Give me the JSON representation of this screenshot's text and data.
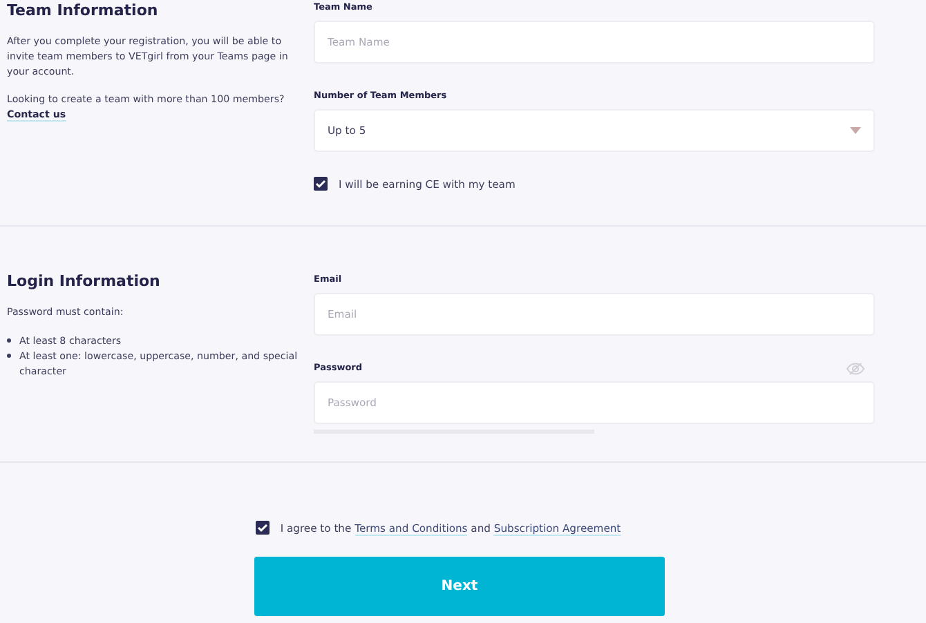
{
  "team_information": {
    "heading": "Team Information",
    "description": "After you complete your registration, you will be able to invite team members to VETgirl from your Teams page in your account.",
    "question": "Looking to create a team with more than 100 members?",
    "contact_link": "Contact us"
  },
  "team_fields": {
    "team_name": {
      "label": "Team Name",
      "placeholder": "Team Name"
    },
    "members": {
      "label": "Number of Team Members",
      "value": "Up to 5"
    },
    "ce_checkbox": {
      "label": "I will be earning CE with my team",
      "checked": true
    }
  },
  "login_information": {
    "heading": "Login Information",
    "intro": "Password must contain:",
    "rules": [
      "At least 8 characters",
      "At least one: lowercase, uppercase, number, and special character"
    ]
  },
  "login_fields": {
    "email": {
      "label": "Email",
      "placeholder": "Email"
    },
    "password": {
      "label": "Password",
      "placeholder": "Password"
    }
  },
  "agreement": {
    "checked": true,
    "parts": [
      {
        "kind": "text",
        "text": "I agree to the "
      },
      {
        "kind": "link",
        "text": "Terms and Conditions"
      },
      {
        "kind": "text",
        "text": " and "
      },
      {
        "kind": "link",
        "text": "Subscription Agreement"
      }
    ]
  },
  "next_button": "Next"
}
